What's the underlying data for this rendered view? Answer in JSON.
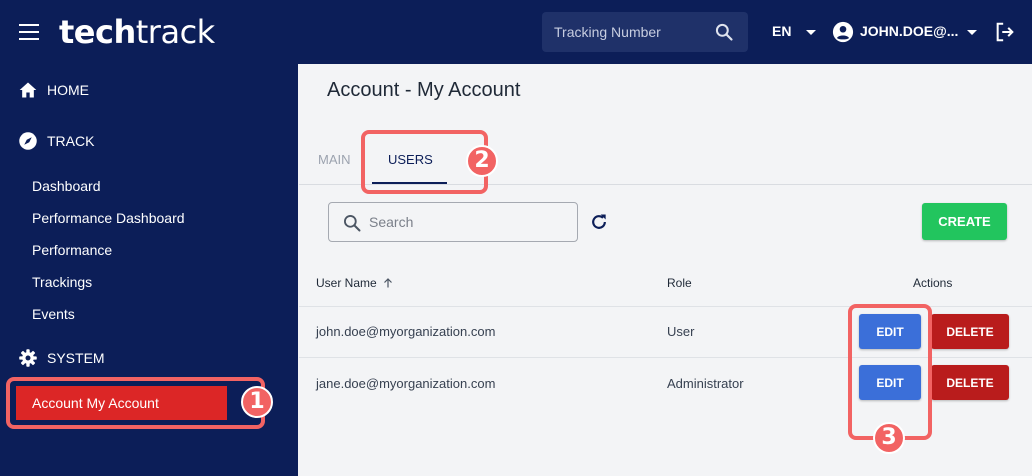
{
  "brand": {
    "logo_bold": "tech",
    "logo_light": "track"
  },
  "topbar": {
    "tracking_placeholder": "Tracking Number",
    "language": "EN",
    "user_name": "JOHN.DOE@..."
  },
  "sidebar": {
    "home_label": "HOME",
    "track_label": "TRACK",
    "track_items": [
      "Dashboard",
      "Performance Dashboard",
      "Performance",
      "Trackings",
      "Events"
    ],
    "system_label": "SYSTEM",
    "system_items": [
      "Account My Account"
    ]
  },
  "page": {
    "title": "Account - My Account",
    "tabs": [
      "MAIN",
      "USERS"
    ],
    "active_tab": "USERS"
  },
  "users": {
    "search_placeholder": "Search",
    "create_label": "CREATE",
    "columns": [
      "User Name",
      "Role",
      "Actions"
    ],
    "rows": [
      {
        "user_name": "john.doe@myorganization.com",
        "role": "User",
        "edit": "EDIT",
        "delete": "DELETE"
      },
      {
        "user_name": "jane.doe@myorganization.com",
        "role": "Administrator",
        "edit": "EDIT",
        "delete": "DELETE"
      }
    ]
  },
  "annotations": {
    "step1": "1",
    "step2": "2",
    "step3": "3"
  },
  "colors": {
    "navy": "#0c1e58",
    "create_green": "#22c55e",
    "edit_blue": "#3b6fd9",
    "delete_red": "#b91c1c",
    "active_red": "#dc2626",
    "callout": "#f26363"
  },
  "icons": {
    "menu": "hamburger-menu-icon",
    "search": "search-icon",
    "caret": "caret-down-icon",
    "account": "account-circle-icon",
    "logout": "logout-icon",
    "home": "home-icon",
    "track": "compass-icon",
    "system": "gear-icon",
    "refresh": "refresh-icon",
    "sort": "sort-arrow-up-icon"
  }
}
